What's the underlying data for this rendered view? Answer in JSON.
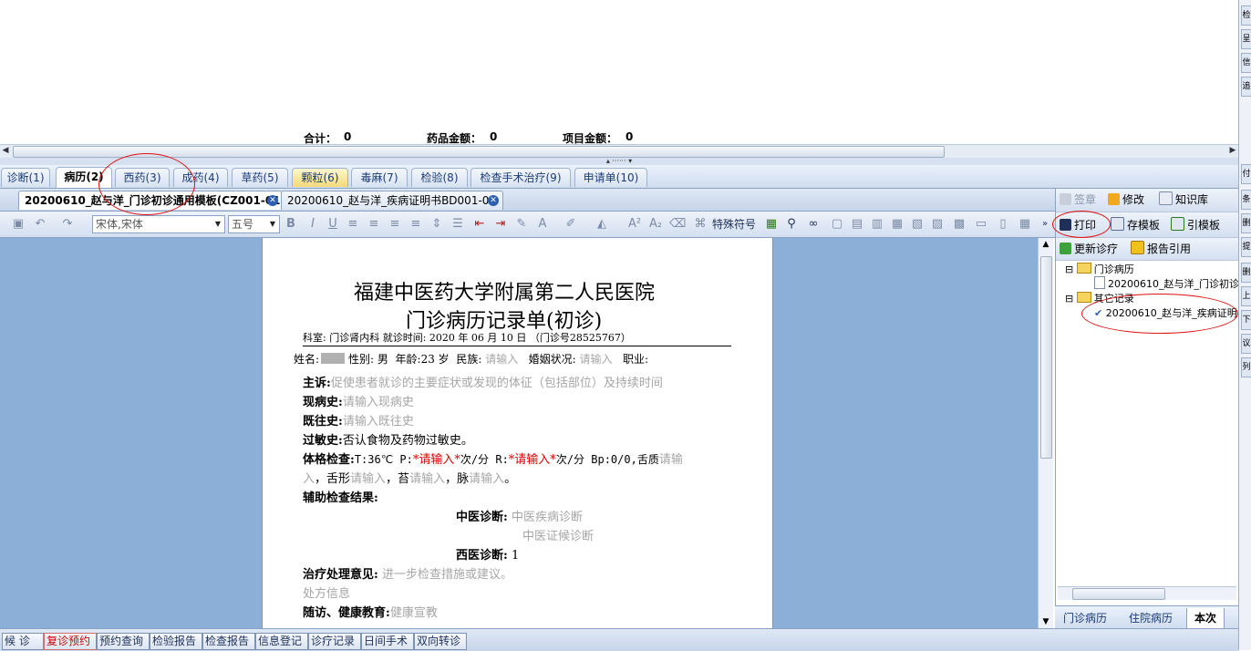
{
  "totals": {
    "total_label": "合计：",
    "total_value": "0",
    "drug_label": "药品金额：",
    "drug_value": "0",
    "item_label": "项目金额：",
    "item_value": "0"
  },
  "main_tabs": [
    {
      "label": "诊断(1)"
    },
    {
      "label": "病历(2)"
    },
    {
      "label": "西药(3)"
    },
    {
      "label": "成药(4)"
    },
    {
      "label": "草药(5)"
    },
    {
      "label": "颗粒(6)"
    },
    {
      "label": "毒麻(7)"
    },
    {
      "label": "检验(8)"
    },
    {
      "label": "检查手术治疗(9)"
    },
    {
      "label": "申请单(10)"
    }
  ],
  "doc_tabs": [
    {
      "label": "20200610_赵与洋_门诊初诊通用模板(CZ001-01)"
    },
    {
      "label": "20200610_赵与洋_疾病证明书BD001-01"
    }
  ],
  "toolbar": {
    "font_name": "宋体,宋体",
    "font_size": "五号",
    "special_chars": "特殊符号"
  },
  "document": {
    "hospital": "福建中医药大学附属第二人民医院",
    "form_title": "门诊病历记录单(初诊)",
    "dept_line": "科室: 门诊肾内科  就诊时间: 2020 年 06 月 10 日 （门诊号28525767）",
    "name_label": "姓名:",
    "gender": "性别: 男",
    "age": "年龄:23 岁",
    "ethnic_label": "民族:",
    "ethnic_ph": "请输入",
    "marital_label": "婚姻状况:",
    "marital_ph": "请输入",
    "job_label": "职业:",
    "cc_label": "主诉:",
    "cc_ph": "促使患者就诊的主要症状或发现的体征（包括部位）及持续时间",
    "hpi_label": "现病史:",
    "hpi_ph": "请输入现病史",
    "pmh_label": "既往史:",
    "pmh_ph": "请输入既往史",
    "allergy_label": "过敏史:",
    "allergy_val": "否认食物及药物过敏史。",
    "exam_label": "体格检查:",
    "exam_t": "T:36℃   P:",
    "exam_p_ph": "*请输入*",
    "exam_p_unit": "次/分  R:",
    "exam_r_ph": "*请输入*",
    "exam_r_unit": "次/分  Bp:0/0,舌质",
    "exam_tongue_ph": "请输",
    "exam_line2_a": "入",
    "exam_line2_b": "，舌形",
    "exam_line2_c": "请输入",
    "exam_line2_d": "，苔",
    "exam_line2_e": "请输入",
    "exam_line2_f": "，脉",
    "exam_line2_g": "请输入",
    "exam_line2_h": "。",
    "aux_label": "辅助检查结果:",
    "tcm_label": "中医诊断:",
    "tcm_ph1": "中医疾病诊断",
    "tcm_ph2": "中医证候诊断",
    "wm_label": "西医诊断:",
    "wm_val": "1",
    "treat_label": "治疗处理意见:",
    "treat_ph": "进一步检查措施或建议。",
    "rx_ph": "处方信息",
    "followup_label": "随访、健康教育:",
    "followup_ph": "健康宣教"
  },
  "right_panel": {
    "sign": "签章",
    "modify": "修改",
    "knowledge": "知识库",
    "print": "打印",
    "save_tpl": "存模板",
    "cite_tpl": "引模板",
    "refresh": "更新诊疗",
    "report_ref": "报告引用",
    "tree": {
      "folder1": "门诊病历",
      "item1": "20200610_赵与洋_门诊初诊",
      "folder2": "其它记录",
      "item2": "20200610_赵与洋_疾病证明"
    },
    "tabs": [
      {
        "label": "门诊病历"
      },
      {
        "label": "住院病历"
      },
      {
        "label": "本次"
      }
    ]
  },
  "bottom_bar": [
    {
      "label": "候 诊"
    },
    {
      "label": "复诊预约"
    },
    {
      "label": "预约查询"
    },
    {
      "label": "检验报告"
    },
    {
      "label": "检查报告"
    },
    {
      "label": "信息登记"
    },
    {
      "label": "诊疗记录"
    },
    {
      "label": "日间手术"
    },
    {
      "label": "双向转诊"
    }
  ],
  "right_strip": [
    "检",
    "呈",
    "信",
    "追",
    "付",
    "条",
    "删",
    "提",
    "删",
    "上",
    "下",
    "议",
    "列"
  ],
  "colors": {
    "accent": "#2b5fb0",
    "editor_bg": "#8cafd8",
    "annotation": "#e01010",
    "required_red": "#e00000"
  }
}
